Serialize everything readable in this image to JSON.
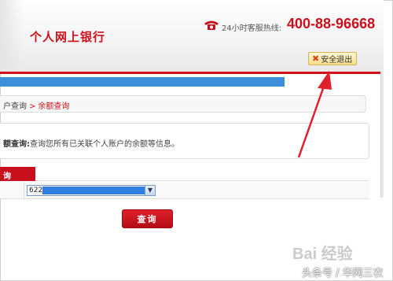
{
  "header": {
    "title": "个人网上银行",
    "hotline_label": "24小时客服热线:",
    "hotline_number": "400-88-96668",
    "logout_label": "安全退出"
  },
  "progress": {
    "fill_fraction": 0.75
  },
  "breadcrumb": {
    "parent": "户查询",
    "separator": ">",
    "current": "余额查询"
  },
  "info": {
    "label": "额查询:",
    "text": "查询您所有已关联个人账户的余额等信息。"
  },
  "table": {
    "tab_label": "询",
    "account_select_value": "622"
  },
  "actions": {
    "query_label": "查询"
  },
  "watermarks": {
    "baidu": "Bai 经验",
    "source": "头条号 / 华网三农"
  },
  "colors": {
    "brand_red": "#c8101c",
    "highlight_blue": "#3c8ed8",
    "annotation_arrow": "#e0202a"
  },
  "icons": {
    "phone": "phone-icon",
    "logout": "close-icon",
    "dropdown": "chevron-down-icon"
  }
}
